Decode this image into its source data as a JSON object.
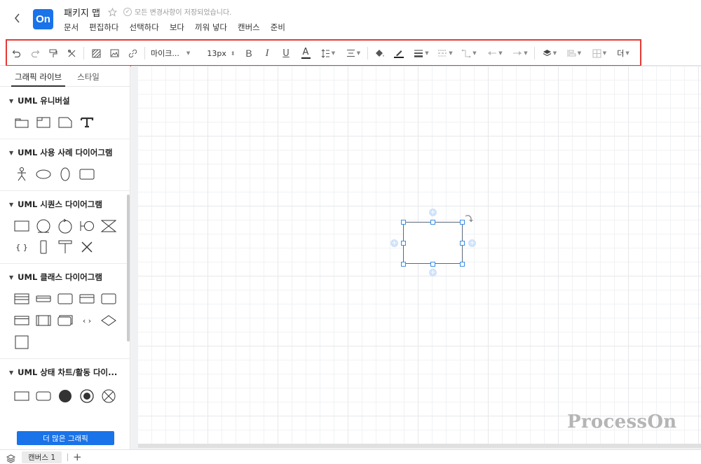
{
  "header": {
    "logo_text": "On",
    "title": "패키지 맵",
    "save_status": "모든 변경사항이 저장되었습니다.",
    "menu": [
      "문서",
      "편집하다",
      "선택하다",
      "보다",
      "끼워 넣다",
      "캔버스",
      "준비"
    ]
  },
  "toolbar": {
    "font_name": "마이크...",
    "font_size": "13px",
    "bold": "B",
    "italic": "I",
    "underline": "U",
    "font_color": "A",
    "more": "더",
    "icons": [
      "undo-icon",
      "redo-icon",
      "format-painter-icon",
      "clear-format-icon",
      "fill-style-icon",
      "image-icon",
      "link-icon",
      "line-height-icon",
      "align-icon",
      "fill-color-icon",
      "line-color-icon",
      "line-width-icon",
      "line-style-icon",
      "connector-icon",
      "start-arrow-icon",
      "end-arrow-icon",
      "layer-icon",
      "align-shapes-icon",
      "distribute-icon"
    ],
    "highlight_color": "#e53935"
  },
  "sidebar": {
    "tabs": [
      "그래픽 라이브",
      "스타일"
    ],
    "sections": [
      "UML 유니버설",
      "UML 사용 사례 다이어그램",
      "UML 시퀀스 다이어그램",
      "UML 클래스 다이어그램",
      "UML 상태 차트/활동 다이..."
    ],
    "braces_label": "{ }",
    "chevrons_label": "‹ ›",
    "more_button": "더 많은 그래픽"
  },
  "canvas": {
    "watermark": "ProcessOn",
    "accent_color": "#1a73e8"
  },
  "footer": {
    "page_tab": "캔버스 1",
    "add_label": "+"
  }
}
